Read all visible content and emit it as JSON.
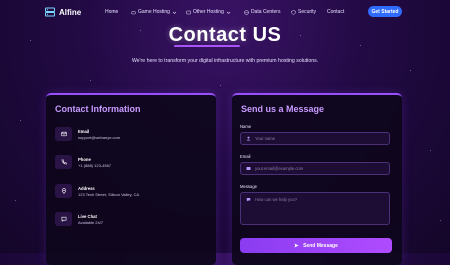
{
  "brand": {
    "name": "Alfine"
  },
  "nav": {
    "items": [
      {
        "label": "Home",
        "icon": "none"
      },
      {
        "label": "Game Hosting",
        "icon": "gamepad-icon"
      },
      {
        "label": "Other Hosting",
        "icon": "server-icon"
      },
      {
        "label": "Data Centers",
        "icon": "globe-icon"
      },
      {
        "label": "Security",
        "icon": "shield-icon"
      },
      {
        "label": "Contact",
        "icon": "none"
      }
    ],
    "cta": "Get Started"
  },
  "hero": {
    "title_part1": "Contact",
    "title_part2": "US",
    "subtitle": "We're here to transform your digital infrastructure with premium hosting solutions."
  },
  "contact_info": {
    "title": "Contact Information",
    "items": [
      {
        "label": "Email",
        "value": "support@webanye.com",
        "icon": "mail-icon"
      },
      {
        "label": "Phone",
        "value": "+1 (888) 123-4567",
        "icon": "phone-icon"
      },
      {
        "label": "Address",
        "value": "123 Tech Street, Silicon Valley, CA",
        "icon": "location-icon"
      },
      {
        "label": "Live Chat",
        "value": "Available 24/7",
        "icon": "chat-icon"
      }
    ]
  },
  "message_form": {
    "title": "Send us a Message",
    "name_label": "Name",
    "name_placeholder": "Your name",
    "email_label": "Email",
    "email_placeholder": "your.email@example.com",
    "message_label": "Message",
    "message_placeholder": "How can we help you?",
    "submit": "Send Message"
  },
  "colors": {
    "accent": "#a855f7",
    "cta": "#2f6bff",
    "background": "#220a44"
  }
}
